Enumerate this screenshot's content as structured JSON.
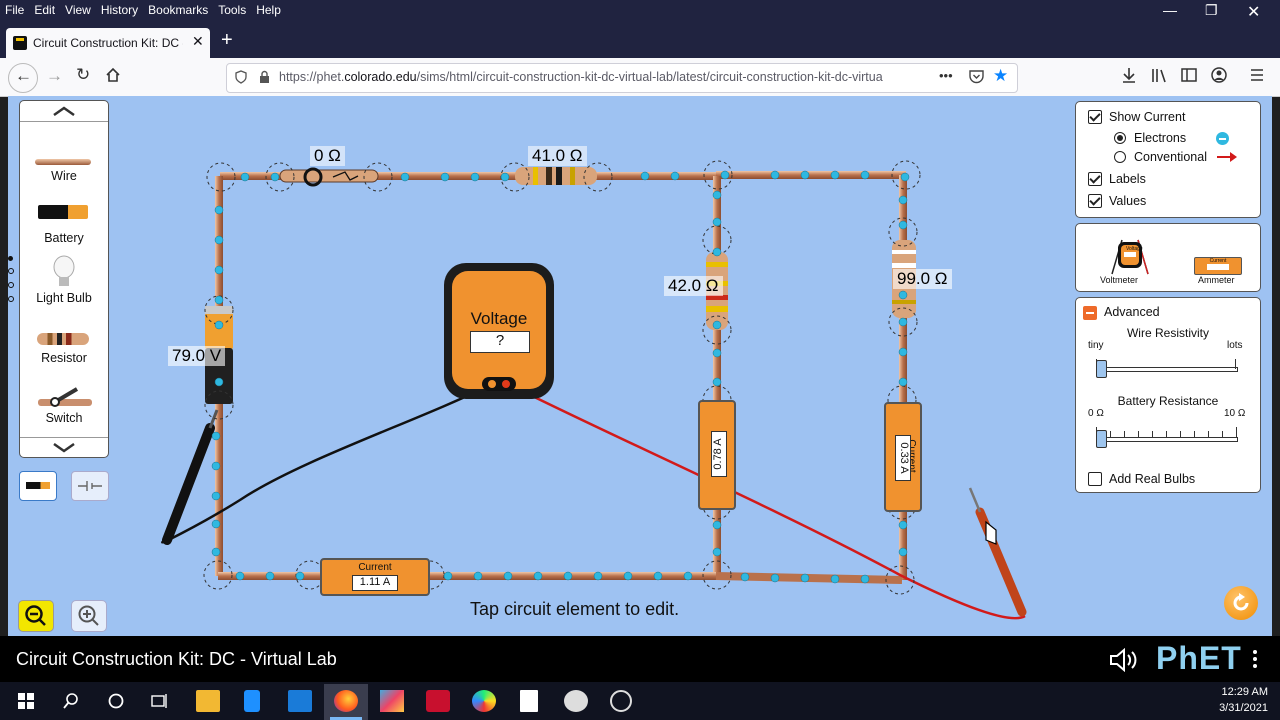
{
  "browser": {
    "menu": [
      "File",
      "Edit",
      "View",
      "History",
      "Bookmarks",
      "Tools",
      "Help"
    ],
    "tab_title": "Circuit Construction Kit: DC - V",
    "url_prefix": "https://phet.",
    "url_domain": "colorado.edu",
    "url_rest": "/sims/html/circuit-construction-kit-dc-virtual-lab/latest/circuit-construction-kit-dc-virtua",
    "more_label": "•••"
  },
  "toolbox": {
    "items": [
      {
        "label": "Wire"
      },
      {
        "label": "Battery"
      },
      {
        "label": "Light Bulb"
      },
      {
        "label": "Resistor"
      },
      {
        "label": "Switch"
      }
    ]
  },
  "circuit": {
    "switch_label": "0 Ω",
    "r1_label": "41.0 Ω",
    "r2_label": "42.0 Ω",
    "r3_label": "99.0 Ω",
    "battery_label": "79.0 V",
    "ammeter1": {
      "title": "Current",
      "value": "1.11 A"
    },
    "ammeter2": {
      "title": "Current",
      "value": "0.78 A"
    },
    "ammeter3": {
      "title": "Current",
      "value": "0.33 A"
    },
    "voltmeter_title": "Voltage",
    "voltmeter_value": "?",
    "hint": "Tap circuit element to edit."
  },
  "view_panel": {
    "show_current": "Show Current",
    "show_current_checked": true,
    "electrons": "Electrons",
    "conventional": "Conventional",
    "selected": "Electrons",
    "labels": "Labels",
    "labels_checked": true,
    "values": "Values",
    "values_checked": true
  },
  "sensors": {
    "voltmeter": "Voltmeter",
    "ammeter": "Ammeter",
    "voltmeter_icon_text": "Voltage",
    "ammeter_icon_text": "Current"
  },
  "advanced": {
    "title": "Advanced",
    "wire_resistivity": "Wire Resistivity",
    "wr_min": "tiny",
    "wr_max": "lots",
    "wr_level": 0.0,
    "battery_resistance": "Battery Resistance",
    "br_min": "0 Ω",
    "br_max": "10 Ω",
    "br_level": 0.0,
    "add_real_bulbs": "Add Real Bulbs",
    "add_real_bulbs_checked": false
  },
  "footer": {
    "sim_title": "Circuit Construction Kit: DC - Virtual Lab",
    "brand": "PhET"
  },
  "taskbar": {
    "time": "12:29 AM",
    "date": "3/31/2021"
  },
  "colors": {
    "sim_bg": "#9ec2f2",
    "wire": "#c98f6e",
    "electron": "#2fb8e0",
    "meter": "#f0922f",
    "probe_red": "#d21a1a"
  }
}
